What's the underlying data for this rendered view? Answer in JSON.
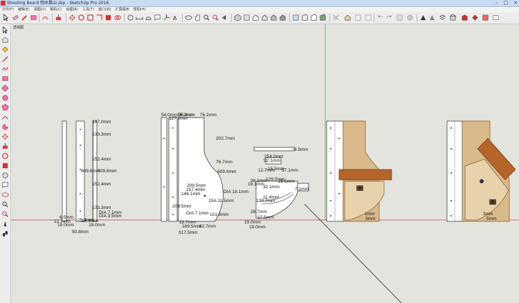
{
  "window": {
    "title": "Shooting Board 刨木靠山.skp - SketchUp Pro 2016"
  },
  "menu": [
    "文件(F)",
    "编辑(E)",
    "视图(V)",
    "相机(C)",
    "绘图(R)",
    "工具(T)",
    "窗口(W)",
    "扩展程序",
    "帮助(H)"
  ],
  "viewport": {
    "label": "透视图"
  },
  "dims": {
    "p1": [
      "127.0mm",
      "133.3mm",
      "609.6mm",
      "609.6mm",
      "152.4mm",
      "152.4mm",
      "133.3mm",
      "DIA 7.1mm",
      "DIA 3.5mm",
      "12.7mm",
      "19.0mm",
      "19.0mm",
      "6.5mm",
      "50.8mm",
      "25.4mm",
      "15.9mm"
    ],
    "p2": [
      "54.0mm",
      "127.0mm",
      "95.6mm",
      "76.2mm",
      "202.7mm",
      "76.2mm",
      "76.7mm",
      "609.6mm",
      "209.5mm",
      "157.4mm",
      "146.1mm",
      "DIA 11.5mm",
      "209.5mm",
      "DIA 7.1mm",
      "101.6mm",
      "169.5mm",
      "82.7mm",
      "317.5mm",
      "12.7mm"
    ],
    "p3": [
      "254.0mm",
      "9.5mm",
      "92.1mm",
      "12.7mm",
      "57.1mm",
      "15.5mm",
      "129.5mm",
      "19.1mm",
      "DIA 19.1mm",
      "38.1mm",
      "32.1mm",
      "15.5mm",
      "7.1mm",
      "138.2mm",
      "11.4mm",
      "39.7mm",
      "19.0mm",
      "19.0mm",
      "17.5mm"
    ],
    "p4": [
      "1mm",
      "3mm"
    ],
    "p5": [
      "3mm",
      "5mm"
    ]
  }
}
